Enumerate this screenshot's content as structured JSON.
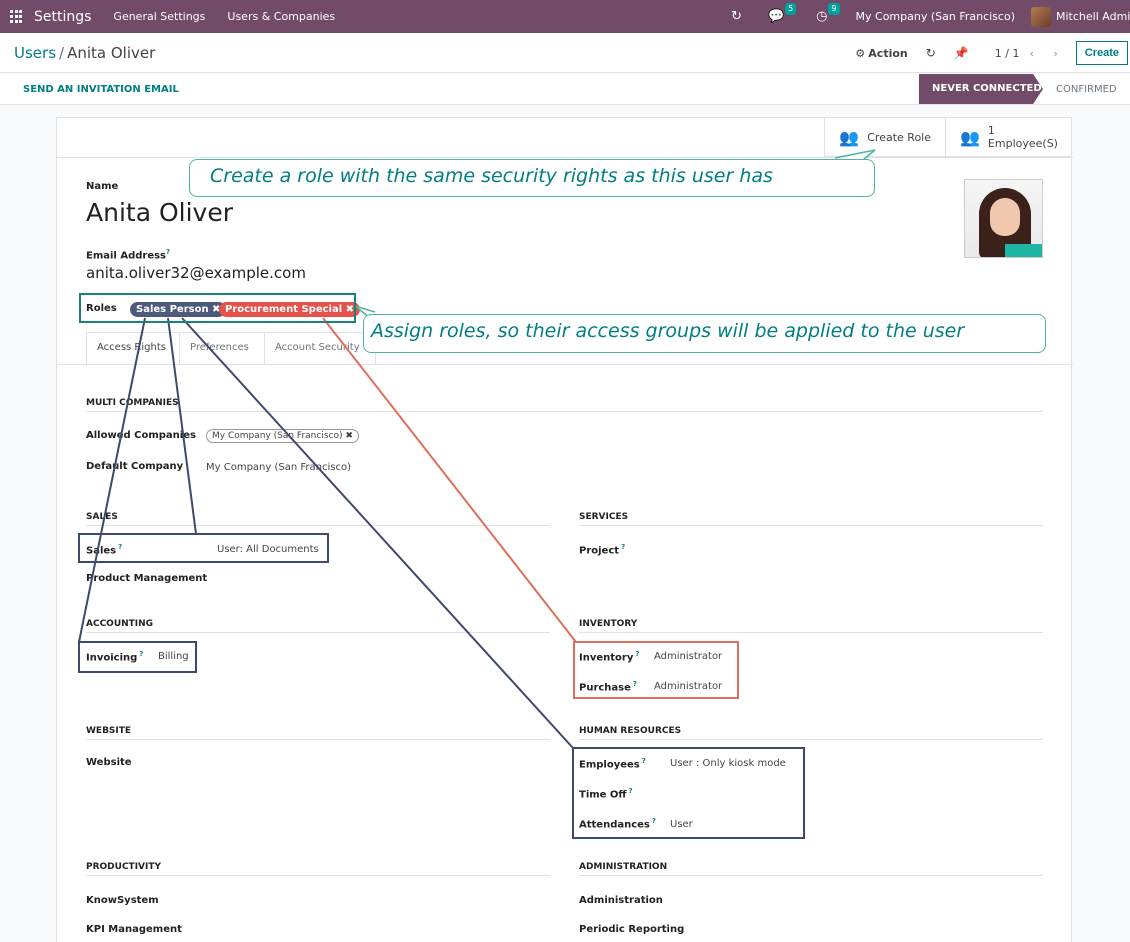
{
  "navbar": {
    "app_title": "Settings",
    "menu": [
      "General Settings",
      "Users & Companies"
    ],
    "chat_count": "5",
    "activity_count": "9",
    "company": "My Company (San Francisco)",
    "user": "Mitchell Admin"
  },
  "control_panel": {
    "breadcrumb_parent": "Users",
    "breadcrumb_sep": "/",
    "breadcrumb_current": "Anita Oliver",
    "action": "Action",
    "pager": "1 / 1",
    "pager_arrows": "‹ ›",
    "create": "Create"
  },
  "statusbar": {
    "invite": "SEND AN INVITATION EMAIL",
    "stage_active": "NEVER CONNECTED",
    "stage_next": "CONFIRMED"
  },
  "stat_buttons": {
    "create_role": "Create Role",
    "employee_count": "1",
    "employee_label": "Employee(S)"
  },
  "form": {
    "name_label": "Name",
    "name": "Anita Oliver",
    "email_label": "Email Address",
    "email": "anita.oliver32@example.com",
    "roles_label": "Roles",
    "roles": [
      "Sales Person ✖",
      "Procurement Special ✖"
    ],
    "tabs": [
      "Access Rights",
      "Preferences",
      "Account Security"
    ]
  },
  "access": {
    "multi_companies": "MULTI COMPANIES",
    "allowed_companies_label": "Allowed Companies",
    "allowed_companies_tag": "My Company (San Francisco) ✖",
    "default_company_label": "Default Company",
    "default_company": "My Company (San Francisco)",
    "sales": "SALES",
    "sales_label": "Sales",
    "sales_value": "User: All Documents",
    "product_management": "Product Management",
    "services": "SERVICES",
    "project": "Project",
    "accounting": "ACCOUNTING",
    "invoicing_label": "Invoicing",
    "invoicing_value": "Billing",
    "inventory_section": "INVENTORY",
    "inventory_label": "Inventory",
    "inventory_value": "Administrator",
    "purchase_label": "Purchase",
    "purchase_value": "Administrator",
    "website_section": "WEBSITE",
    "website": "Website",
    "hr_section": "HUMAN RESOURCES",
    "employees_label": "Employees",
    "employees_value": "User : Only kiosk mode",
    "time_off": "Time Off",
    "attendances_label": "Attendances",
    "attendances_value": "User",
    "productivity": "PRODUCTIVITY",
    "knowsystem": "KnowSystem",
    "kpi": "KPI Management",
    "administration_section": "ADMINISTRATION",
    "administration": "Administration",
    "periodic_reporting": "Periodic Reporting",
    "help_mark": "?"
  },
  "annotations": {
    "create_role_hint": "Create a role with the same security rights as this user has",
    "assign_roles_hint": "Assign roles, so their access groups will be applied to the user"
  },
  "colors": {
    "brand": "#714b67",
    "link": "#017e84",
    "role_blue": "#4d5a7c",
    "role_red": "#e4524a",
    "callout_border": "#4cb5a5"
  }
}
